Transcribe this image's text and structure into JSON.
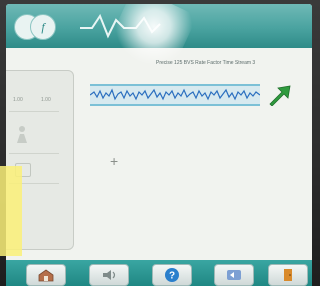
{
  "header": {
    "title_text": "",
    "top_right_text": "",
    "subtitle_text": "Precise 125 BVS Rate Factor Time Stream 3"
  },
  "left_panel": {
    "row1_left": "1.00",
    "row1_right": "1.00"
  },
  "toolbar": {
    "buttons": [
      {
        "icon": "home-icon"
      },
      {
        "icon": "speaker-icon"
      },
      {
        "icon": "help-icon"
      },
      {
        "icon": "sync-icon"
      },
      {
        "icon": "exit-door-icon"
      }
    ]
  },
  "colors": {
    "teal": "#2e8b88",
    "screen": "#f1f3ef",
    "waveform": "#2b6fbf",
    "arrow": "#2f9b3e"
  }
}
